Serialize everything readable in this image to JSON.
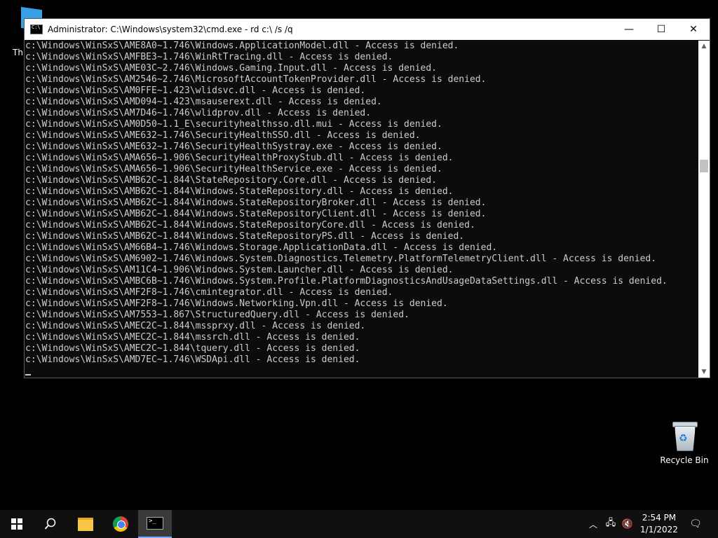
{
  "desktop": {
    "partial_icon_label": "Th",
    "recycle_bin_label": "Recycle Bin"
  },
  "window": {
    "title": "Administrator: C:\\Windows\\system32\\cmd.exe - rd  c:\\ /s /q",
    "minimize": "—",
    "maximize": "☐",
    "close": "✕",
    "lines": [
      "c:\\Windows\\WinSxS\\AME8A0~1.746\\Windows.ApplicationModel.dll - Access is denied.",
      "c:\\Windows\\WinSxS\\AMFBE3~1.746\\WinRtTracing.dll - Access is denied.",
      "c:\\Windows\\WinSxS\\AME03C~2.746\\Windows.Gaming.Input.dll - Access is denied.",
      "c:\\Windows\\WinSxS\\AM2546~2.746\\MicrosoftAccountTokenProvider.dll - Access is denied.",
      "c:\\Windows\\WinSxS\\AM0FFE~1.423\\wlidsvc.dll - Access is denied.",
      "c:\\Windows\\WinSxS\\AMD094~1.423\\msauserext.dll - Access is denied.",
      "c:\\Windows\\WinSxS\\AM7D46~1.746\\wlidprov.dll - Access is denied.",
      "c:\\Windows\\WinSxS\\AM0D50~1.1_E\\securityhealthsso.dll.mui - Access is denied.",
      "c:\\Windows\\WinSxS\\AME632~1.746\\SecurityHealthSSO.dll - Access is denied.",
      "c:\\Windows\\WinSxS\\AME632~1.746\\SecurityHealthSystray.exe - Access is denied.",
      "c:\\Windows\\WinSxS\\AMA656~1.906\\SecurityHealthProxyStub.dll - Access is denied.",
      "c:\\Windows\\WinSxS\\AMA656~1.906\\SecurityHealthService.exe - Access is denied.",
      "c:\\Windows\\WinSxS\\AMB62C~1.844\\StateRepository.Core.dll - Access is denied.",
      "c:\\Windows\\WinSxS\\AMB62C~1.844\\Windows.StateRepository.dll - Access is denied.",
      "c:\\Windows\\WinSxS\\AMB62C~1.844\\Windows.StateRepositoryBroker.dll - Access is denied.",
      "c:\\Windows\\WinSxS\\AMB62C~1.844\\Windows.StateRepositoryClient.dll - Access is denied.",
      "c:\\Windows\\WinSxS\\AMB62C~1.844\\Windows.StateRepositoryCore.dll - Access is denied.",
      "c:\\Windows\\WinSxS\\AMB62C~1.844\\Windows.StateRepositoryPS.dll - Access is denied.",
      "c:\\Windows\\WinSxS\\AM66B4~1.746\\Windows.Storage.ApplicationData.dll - Access is denied.",
      "c:\\Windows\\WinSxS\\AM6902~1.746\\Windows.System.Diagnostics.Telemetry.PlatformTelemetryClient.dll - Access is denied.",
      "c:\\Windows\\WinSxS\\AM11C4~1.906\\Windows.System.Launcher.dll - Access is denied.",
      "c:\\Windows\\WinSxS\\AMBC6B~1.746\\Windows.System.Profile.PlatformDiagnosticsAndUsageDataSettings.dll - Access is denied.",
      "c:\\Windows\\WinSxS\\AMF2F8~1.746\\cmintegrator.dll - Access is denied.",
      "c:\\Windows\\WinSxS\\AMF2F8~1.746\\Windows.Networking.Vpn.dll - Access is denied.",
      "c:\\Windows\\WinSxS\\AM7553~1.867\\StructuredQuery.dll - Access is denied.",
      "c:\\Windows\\WinSxS\\AMEC2C~1.844\\mssprxy.dll - Access is denied.",
      "c:\\Windows\\WinSxS\\AMEC2C~1.844\\mssrch.dll - Access is denied.",
      "c:\\Windows\\WinSxS\\AMEC2C~1.844\\tquery.dll - Access is denied.",
      "c:\\Windows\\WinSxS\\AMD7EC~1.746\\WSDApi.dll - Access is denied."
    ]
  },
  "taskbar": {
    "time": "2:54 PM",
    "date": "1/1/2022"
  },
  "icons": {
    "search": "search-icon",
    "chevron": "chevron-up-icon",
    "network": "network-icon",
    "volume": "volume-muted-icon",
    "notifications": "notification-icon"
  }
}
